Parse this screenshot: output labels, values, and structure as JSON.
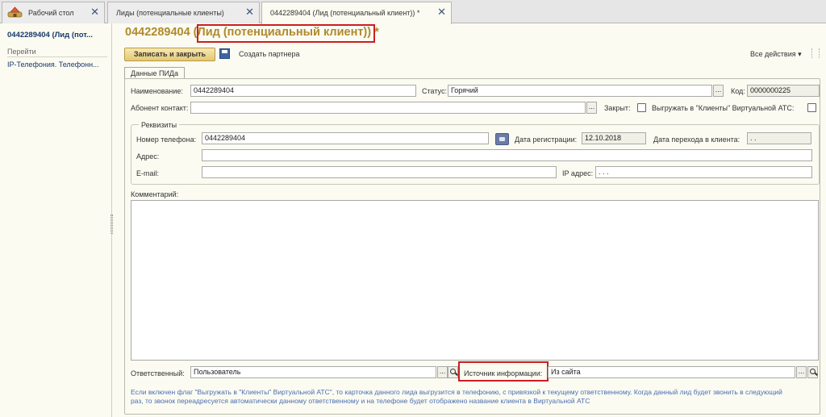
{
  "tabs": [
    {
      "label": "Рабочий стол"
    },
    {
      "label": "Лиды (потенциальные клиенты)"
    },
    {
      "label": "0442289404 (Лид (потенциальный клиент)) *"
    }
  ],
  "sidebar": {
    "title": "0442289404 (Лид (пот...",
    "go_label": "Перейти",
    "items": [
      "IP-Телефония. Телефонн..."
    ]
  },
  "header": {
    "title_number": "0442289404",
    "title_type": "Лид (потенциальный клиент)",
    "title_suffix": " *",
    "save_close": "Записать и закрыть",
    "create_partner": "Создать партнера",
    "all_actions": "Все действия",
    "all_actions_arrow": "▾"
  },
  "form_tab": "Данные ПИДа",
  "fields": {
    "name_label": "Наименование:",
    "name_value": "0442289404",
    "status_label": "Статус:",
    "status_value": "Горячий",
    "code_label": "Код:",
    "code_value": "0000000225",
    "subscriber_label": "Абонент контакт:",
    "subscriber_value": "",
    "closed_label": "Закрыт:",
    "export_label": "Выгружать в \"Клиенты\" Виртуальной АТС:",
    "requisites_title": "Реквизиты",
    "phone_label": "Номер телефона:",
    "phone_value": "0442289404",
    "reg_date_label": "Дата регистрации:",
    "reg_date_value": "12.10.2018",
    "transfer_date_label": "Дата перехода в клиента:",
    "transfer_date_value": " .  .",
    "address_label": "Адрес:",
    "address_value": "",
    "email_label": "E-mail:",
    "email_value": "",
    "ip_label": "IP адрес:",
    "ip_value": "  .   .   .",
    "comment_label": "Комментарий:",
    "responsible_label": "Ответственный:",
    "responsible_value": "Пользователь",
    "source_label": "Источник информации:",
    "source_value": "Из сайта",
    "pick_glyph": "..."
  },
  "note": "Если включен флаг \"Выгружать в \"Клиенты\" Виртуальной АТС\", то карточка данного лида выгрузится в телефонию, с привязкой к текущему ответственному. Когда данный лид будет звонить в следующий раз, то звонок переадресуется автоматически данному ответственному и на телефоне будет отображено название клиента в Виртуальной АТС",
  "colors": {
    "title": "#b08a2b",
    "highlight": "#cc1f1f",
    "link": "#1b3a6b",
    "note": "#4a6eb0"
  }
}
